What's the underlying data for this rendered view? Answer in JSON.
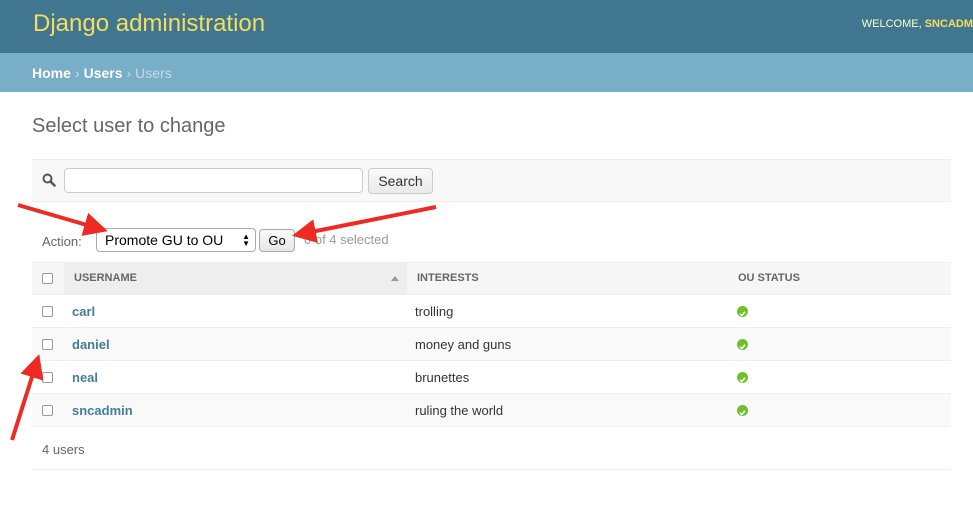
{
  "header": {
    "brand": "Django administration",
    "welcome_prefix": "WELCOME, ",
    "welcome_user": "SNCADM"
  },
  "breadcrumb": {
    "home": "Home",
    "sep1": "›",
    "users_app": "Users",
    "sep2": "›",
    "current": "Users"
  },
  "page": {
    "title": "Select user to change"
  },
  "search": {
    "value": "",
    "button_label": "Search",
    "icon": "search-icon"
  },
  "actions": {
    "label": "Action:",
    "selected_option": "Promote GU to OU",
    "go_label": "Go",
    "selected_count": "0 of 4 selected"
  },
  "table": {
    "columns": [
      "USERNAME",
      "INTERESTS",
      "OU STATUS"
    ],
    "rows": [
      {
        "username": "carl",
        "interests": "trolling",
        "ou_status": "check-icon"
      },
      {
        "username": "daniel",
        "interests": "money and guns",
        "ou_status": "check-icon"
      },
      {
        "username": "neal",
        "interests": "brunettes",
        "ou_status": "check-icon"
      },
      {
        "username": "sncadmin",
        "interests": "ruling the world",
        "ou_status": "check-icon"
      }
    ]
  },
  "footer": {
    "count": "4 users"
  },
  "colors": {
    "header_bg": "#417690",
    "brand": "#f5dd5d",
    "breadcrumb_bg": "#79aec8",
    "link": "#447e9b",
    "status_ok": "#70bf2b",
    "annotation_arrow": "#ee2a24"
  }
}
